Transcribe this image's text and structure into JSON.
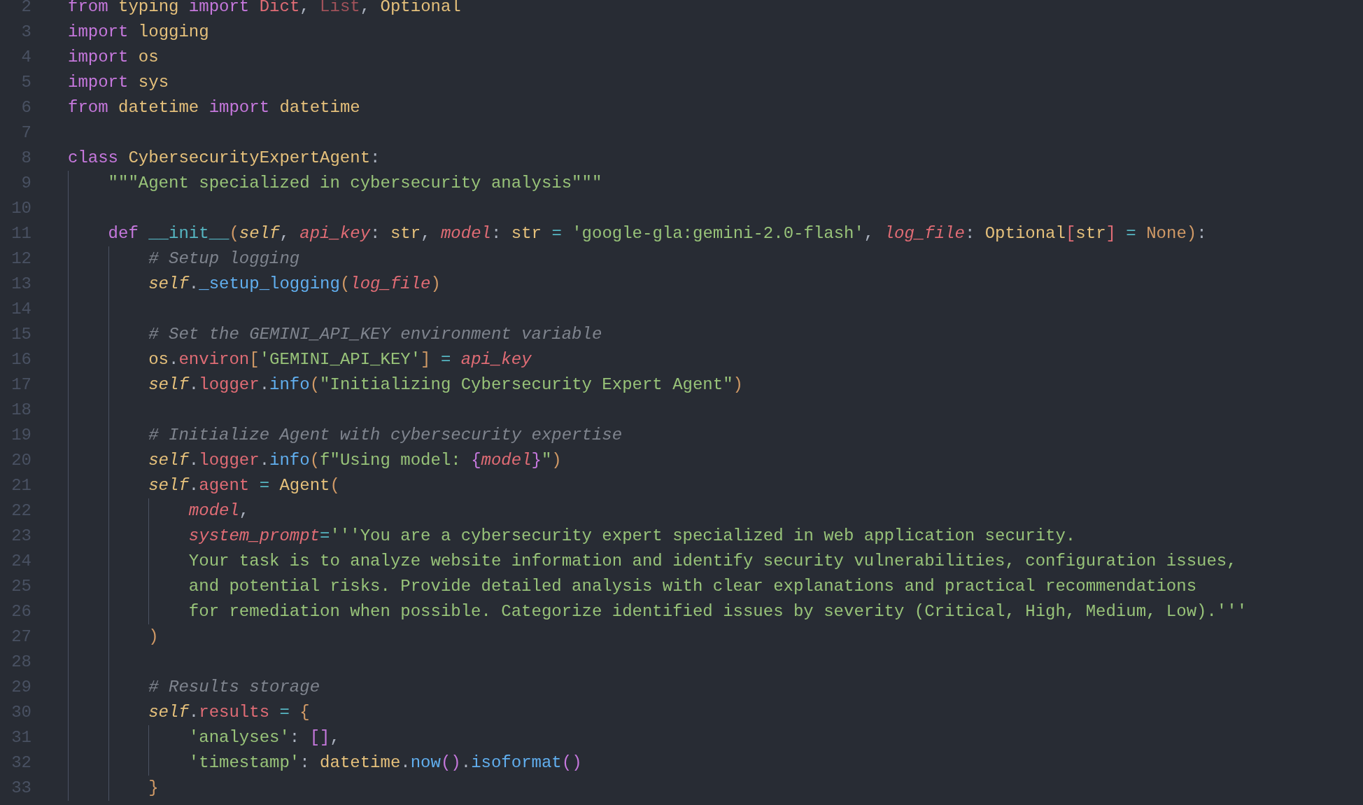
{
  "editor": {
    "lines": [
      {
        "number": "2",
        "tokens": [
          {
            "kind": "kw",
            "text": "from "
          },
          {
            "kind": "type",
            "text": "typing "
          },
          {
            "kind": "kw",
            "text": "import "
          },
          {
            "kind": "prop",
            "text": "Dict"
          },
          {
            "kind": "plain",
            "text": ", "
          },
          {
            "kind": "unused",
            "text": "List"
          },
          {
            "kind": "plain",
            "text": ", "
          },
          {
            "kind": "type",
            "text": "Optional"
          }
        ]
      },
      {
        "number": "3",
        "tokens": [
          {
            "kind": "kw",
            "text": "import "
          },
          {
            "kind": "type",
            "text": "logging"
          }
        ]
      },
      {
        "number": "4",
        "tokens": [
          {
            "kind": "kw",
            "text": "import "
          },
          {
            "kind": "type",
            "text": "os"
          }
        ]
      },
      {
        "number": "5",
        "tokens": [
          {
            "kind": "kw",
            "text": "import "
          },
          {
            "kind": "type",
            "text": "sys"
          }
        ]
      },
      {
        "number": "6",
        "tokens": [
          {
            "kind": "kw",
            "text": "from "
          },
          {
            "kind": "type",
            "text": "datetime "
          },
          {
            "kind": "kw",
            "text": "import "
          },
          {
            "kind": "type",
            "text": "datetime"
          }
        ]
      },
      {
        "number": "7"
      },
      {
        "number": "8",
        "tokens": [
          {
            "kind": "kw",
            "text": "class "
          },
          {
            "kind": "type",
            "text": "CybersecurityExpertAgent"
          },
          {
            "kind": "plain",
            "text": ":"
          }
        ]
      },
      {
        "number": "9",
        "tokens": [
          {
            "kind": "str",
            "text": "    \"\"\"Agent specialized in cybersecurity analysis\"\"\""
          }
        ]
      },
      {
        "number": "10"
      },
      {
        "number": "11",
        "tokens": [
          {
            "kind": "kw",
            "text": "    def "
          },
          {
            "kind": "magic",
            "text": "__init__"
          },
          {
            "kind": "punct",
            "text": "("
          },
          {
            "kind": "self",
            "text": "self"
          },
          {
            "kind": "plain",
            "text": ", "
          },
          {
            "kind": "param",
            "text": "api_key"
          },
          {
            "kind": "plain",
            "text": ": "
          },
          {
            "kind": "type",
            "text": "str"
          },
          {
            "kind": "plain",
            "text": ", "
          },
          {
            "kind": "param",
            "text": "model"
          },
          {
            "kind": "plain",
            "text": ": "
          },
          {
            "kind": "type",
            "text": "str "
          },
          {
            "kind": "op",
            "text": "= "
          },
          {
            "kind": "str",
            "text": "'google-gla:gemini-2.0-flash'"
          },
          {
            "kind": "plain",
            "text": ", "
          },
          {
            "kind": "param",
            "text": "log_file"
          },
          {
            "kind": "plain",
            "text": ": "
          },
          {
            "kind": "type",
            "text": "Optional"
          },
          {
            "kind": "prop",
            "text": "["
          },
          {
            "kind": "type",
            "text": "str"
          },
          {
            "kind": "prop",
            "text": "] "
          },
          {
            "kind": "op",
            "text": "= "
          },
          {
            "kind": "const",
            "text": "None"
          },
          {
            "kind": "punct",
            "text": ")"
          },
          {
            "kind": "plain",
            "text": ":"
          }
        ]
      },
      {
        "number": "12",
        "tokens": [
          {
            "kind": "comment",
            "text": "        # Setup logging"
          }
        ]
      },
      {
        "number": "13",
        "tokens": [
          {
            "kind": "self",
            "text": "        self"
          },
          {
            "kind": "plain",
            "text": "."
          },
          {
            "kind": "fn",
            "text": "_setup_logging"
          },
          {
            "kind": "punct",
            "text": "("
          },
          {
            "kind": "param",
            "text": "log_file"
          },
          {
            "kind": "punct",
            "text": ")"
          }
        ]
      },
      {
        "number": "14"
      },
      {
        "number": "15",
        "tokens": [
          {
            "kind": "comment",
            "text": "        # Set the GEMINI_API_KEY environment variable"
          }
        ]
      },
      {
        "number": "16",
        "tokens": [
          {
            "kind": "type",
            "text": "        os"
          },
          {
            "kind": "plain",
            "text": "."
          },
          {
            "kind": "prop",
            "text": "environ"
          },
          {
            "kind": "punct",
            "text": "["
          },
          {
            "kind": "str",
            "text": "'GEMINI_API_KEY'"
          },
          {
            "kind": "punct",
            "text": "] "
          },
          {
            "kind": "op",
            "text": "= "
          },
          {
            "kind": "param",
            "text": "api_key"
          }
        ]
      },
      {
        "number": "17",
        "tokens": [
          {
            "kind": "self",
            "text": "        self"
          },
          {
            "kind": "plain",
            "text": "."
          },
          {
            "kind": "prop",
            "text": "logger"
          },
          {
            "kind": "plain",
            "text": "."
          },
          {
            "kind": "fn",
            "text": "info"
          },
          {
            "kind": "punct",
            "text": "("
          },
          {
            "kind": "str",
            "text": "\"Initializing Cybersecurity Expert Agent\""
          },
          {
            "kind": "punct",
            "text": ")"
          }
        ]
      },
      {
        "number": "18"
      },
      {
        "number": "19",
        "tokens": [
          {
            "kind": "comment",
            "text": "        # Initialize Agent with cybersecurity expertise"
          }
        ]
      },
      {
        "number": "20",
        "tokens": [
          {
            "kind": "self",
            "text": "        self"
          },
          {
            "kind": "plain",
            "text": "."
          },
          {
            "kind": "prop",
            "text": "logger"
          },
          {
            "kind": "plain",
            "text": "."
          },
          {
            "kind": "fn",
            "text": "info"
          },
          {
            "kind": "punct",
            "text": "("
          },
          {
            "kind": "str",
            "text": "f\"Using model: "
          },
          {
            "kind": "brace",
            "text": "{"
          },
          {
            "kind": "param",
            "text": "model"
          },
          {
            "kind": "brace",
            "text": "}"
          },
          {
            "kind": "str",
            "text": "\""
          },
          {
            "kind": "punct",
            "text": ")"
          }
        ]
      },
      {
        "number": "21",
        "tokens": [
          {
            "kind": "self",
            "text": "        self"
          },
          {
            "kind": "plain",
            "text": "."
          },
          {
            "kind": "prop",
            "text": "agent "
          },
          {
            "kind": "op",
            "text": "= "
          },
          {
            "kind": "type",
            "text": "Agent"
          },
          {
            "kind": "punct",
            "text": "("
          }
        ]
      },
      {
        "number": "22",
        "tokens": [
          {
            "kind": "param",
            "text": "            model"
          },
          {
            "kind": "plain",
            "text": ","
          }
        ]
      },
      {
        "number": "23",
        "tokens": [
          {
            "kind": "param",
            "text": "            system_prompt"
          },
          {
            "kind": "op",
            "text": "="
          },
          {
            "kind": "str",
            "text": "'''You are a cybersecurity expert specialized in web application security."
          }
        ]
      },
      {
        "number": "24",
        "tokens": [
          {
            "kind": "str",
            "text": "            Your task is to analyze website information and identify security vulnerabilities, configuration issues,"
          }
        ]
      },
      {
        "number": "25",
        "tokens": [
          {
            "kind": "str",
            "text": "            and potential risks. Provide detailed analysis with clear explanations and practical recommendations"
          }
        ]
      },
      {
        "number": "26",
        "tokens": [
          {
            "kind": "str",
            "text": "            for remediation when possible. Categorize identified issues by severity (Critical, High, Medium, Low).'''"
          }
        ]
      },
      {
        "number": "27",
        "tokens": [
          {
            "kind": "punct",
            "text": "        )"
          }
        ]
      },
      {
        "number": "28"
      },
      {
        "number": "29",
        "tokens": [
          {
            "kind": "comment",
            "text": "        # Results storage"
          }
        ]
      },
      {
        "number": "30",
        "tokens": [
          {
            "kind": "self",
            "text": "        self"
          },
          {
            "kind": "plain",
            "text": "."
          },
          {
            "kind": "prop",
            "text": "results "
          },
          {
            "kind": "op",
            "text": "= "
          },
          {
            "kind": "punct",
            "text": "{"
          }
        ]
      },
      {
        "number": "31",
        "tokens": [
          {
            "kind": "str",
            "text": "            'analyses'"
          },
          {
            "kind": "plain",
            "text": ": "
          },
          {
            "kind": "brace",
            "text": "[]"
          },
          {
            "kind": "plain",
            "text": ","
          }
        ]
      },
      {
        "number": "32",
        "tokens": [
          {
            "kind": "str",
            "text": "            'timestamp'"
          },
          {
            "kind": "plain",
            "text": ": "
          },
          {
            "kind": "type",
            "text": "datetime"
          },
          {
            "kind": "plain",
            "text": "."
          },
          {
            "kind": "fn",
            "text": "now"
          },
          {
            "kind": "brace",
            "text": "()"
          },
          {
            "kind": "plain",
            "text": "."
          },
          {
            "kind": "fn",
            "text": "isoformat"
          },
          {
            "kind": "brace",
            "text": "()"
          }
        ]
      },
      {
        "number": "33",
        "tokens": [
          {
            "kind": "punct",
            "text": "        }"
          }
        ]
      }
    ]
  }
}
